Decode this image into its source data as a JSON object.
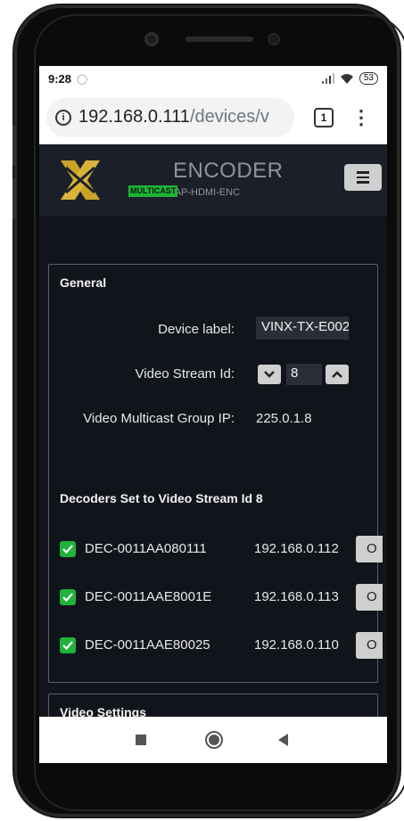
{
  "status": {
    "time": "9:28",
    "battery": "53"
  },
  "browser": {
    "url_host": "192.168.0.111",
    "url_path": "/devices/v",
    "tab_count": "1"
  },
  "header": {
    "title": "ENCODER",
    "badge": "MULTICAST",
    "model": "VINX-210AP-HDMI-ENC"
  },
  "general": {
    "title": "General",
    "device_label_label": "Device label:",
    "device_label_value": "VINX-TX-E002(",
    "stream_id_label": "Video Stream Id:",
    "stream_id_value": "8",
    "multicast_label": "Video Multicast Group IP:",
    "multicast_value": "225.0.1.8"
  },
  "decoders": {
    "title": "Decoders Set to Video Stream Id 8",
    "rows": [
      {
        "name": "DEC-0011AA080111",
        "ip": "192.168.0.112",
        "button": "O"
      },
      {
        "name": "DEC-0011AAE8001E",
        "ip": "192.168.0.113",
        "button": "O"
      },
      {
        "name": "DEC-0011AAE80025",
        "ip": "192.168.0.110",
        "button": "O"
      }
    ]
  },
  "video_settings": {
    "title": "Video Settings"
  },
  "colors": {
    "accent_green": "#1fb33a",
    "logo_gold": "#c9a227",
    "background": "#11141b"
  },
  "icons": [
    "info-icon",
    "menu-dots-icon",
    "hamburger-icon",
    "chevron-down-icon",
    "chevron-up-icon",
    "check-icon",
    "nav-recents-icon",
    "nav-home-icon",
    "nav-back-icon"
  ]
}
